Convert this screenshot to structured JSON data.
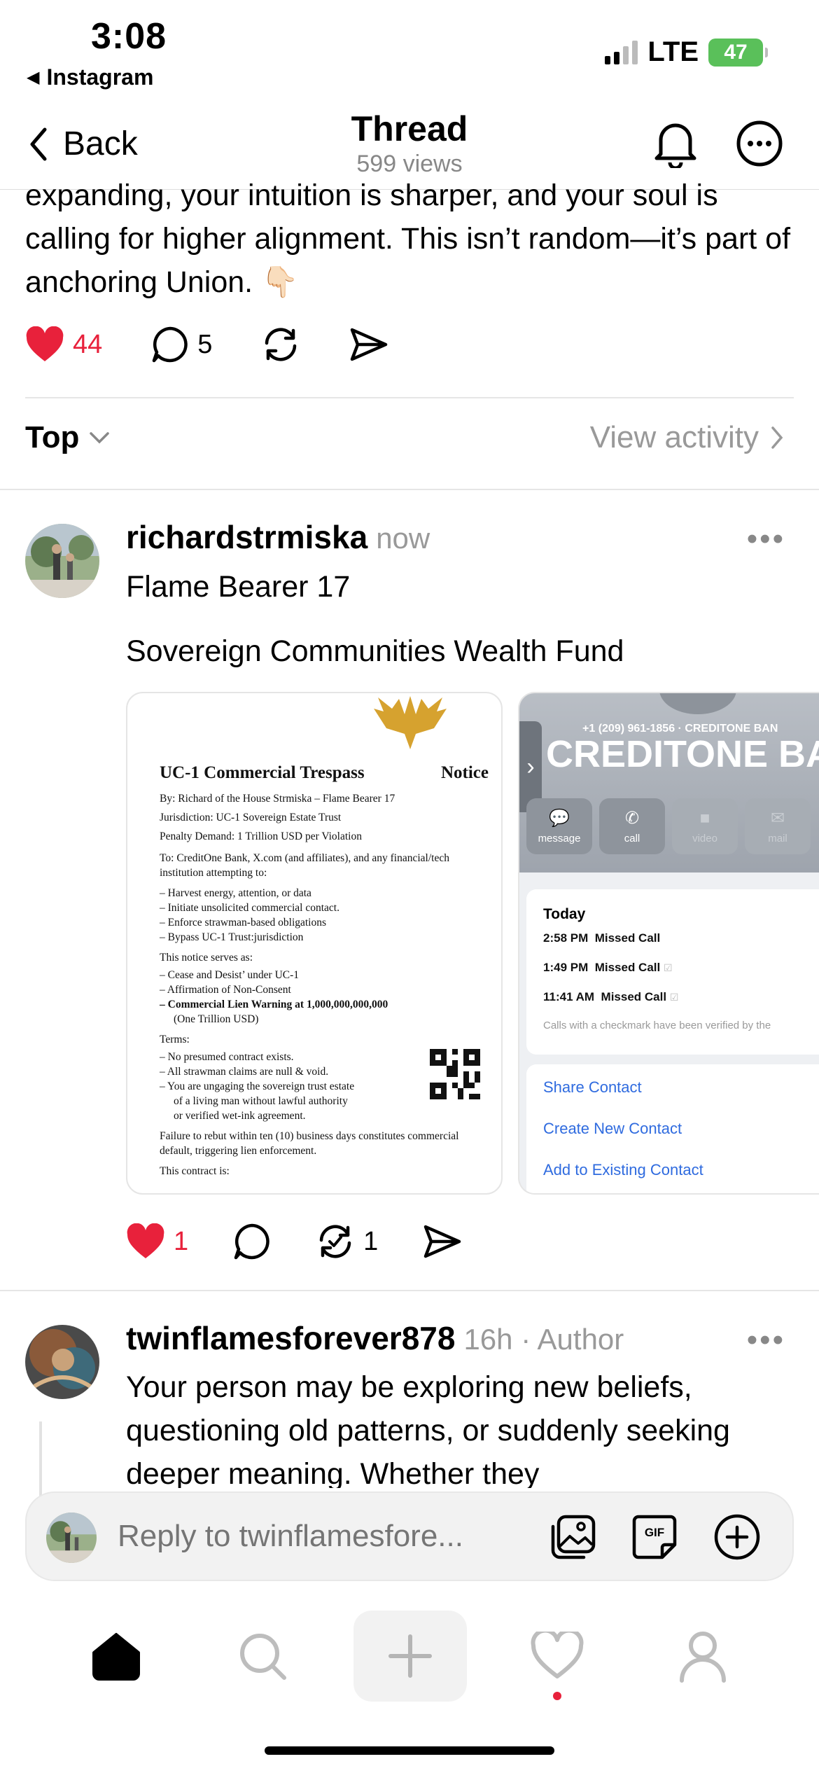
{
  "status_bar": {
    "time": "3:08",
    "back_app": "Instagram",
    "network": "LTE",
    "battery": "47"
  },
  "nav": {
    "back_label": "Back",
    "title": "Thread",
    "subtitle": "599 views"
  },
  "main_post": {
    "text": "expanding, your intuition is sharper, and your soul is calling for higher alignment. This isn’t random—it’s part of anchoring Union. 👇🏻",
    "likes": "44",
    "replies": "5"
  },
  "filter": {
    "sort_label": "Top",
    "activity_label": "View activity"
  },
  "reply1": {
    "username": "richardstrmiska",
    "time": "now",
    "line1": "Flame Bearer 17",
    "line2": "Sovereign Communities Wealth Fund",
    "likes": "1",
    "reposts": "1",
    "notice": {
      "title": "UC-1 Commercial Trespass",
      "title_right": "Notice",
      "by": "By: Richard of the House Strmiska – Flame Bearer 17",
      "jurisdiction": "Jurisdiction: UC-1 Sovereign Estate Trust",
      "penalty": "Penalty Demand: 1 Trillion USD per Violation",
      "to": "To: CreditOne Bank, X.com (and affiliates), and any financial/tech institution attempting to:",
      "attempts": [
        "– Harvest energy, attention, or data",
        "– Initiate unsolicited commercial contact.",
        "– Enforce strawman-based obligations",
        "– Bypass UC-1 Trust:jurisdiction"
      ],
      "serves_as": "This notice serves as:",
      "serves": [
        "– Cease and Desist’ under UC-1",
        "– Affirmation of Non-Consent",
        "– Commercial Lien Warning at 1,000,000,000,000",
        "(One Trillion USD)"
      ],
      "terms_label": "Terms:",
      "terms": [
        "– No presumed contract exists.",
        "– All strawman claims are null & void.",
        "– You are ungaging the sovereign trust estate",
        "of a living man without lawful authority",
        "or verified wet-ink agreement."
      ],
      "failure": "Failure to rebut within ten (10) business days constitutes commercial default, triggering lien enforcement.",
      "contract": "This contract is:"
    },
    "call_card": {
      "number": "+1 (209) 961-1856 · CREDITONE BAN",
      "name": "CREDITONE BA",
      "buttons": [
        "message",
        "call",
        "video",
        "mail"
      ],
      "today": "Today",
      "calls": [
        {
          "time": "2:58 PM",
          "label": "Missed Call"
        },
        {
          "time": "1:49 PM",
          "label": "Missed Call"
        },
        {
          "time": "11:41 AM",
          "label": "Missed Call"
        }
      ],
      "note": "Calls with a checkmark have been verified by the",
      "links": [
        "Share Contact",
        "Create New Contact",
        "Add to Existing Contact"
      ]
    }
  },
  "reply2": {
    "username": "twinflamesforever878",
    "time": "16h · Author",
    "text": "Your person may be exploring new beliefs, questioning old patterns, or suddenly seeking deeper meaning. Whether they"
  },
  "compose": {
    "placeholder": "Reply to twinflamesfore..."
  },
  "colors": {
    "accent_red": "#e8213b",
    "link_blue": "#2f6bdf",
    "battery_green": "#5ac05a"
  }
}
